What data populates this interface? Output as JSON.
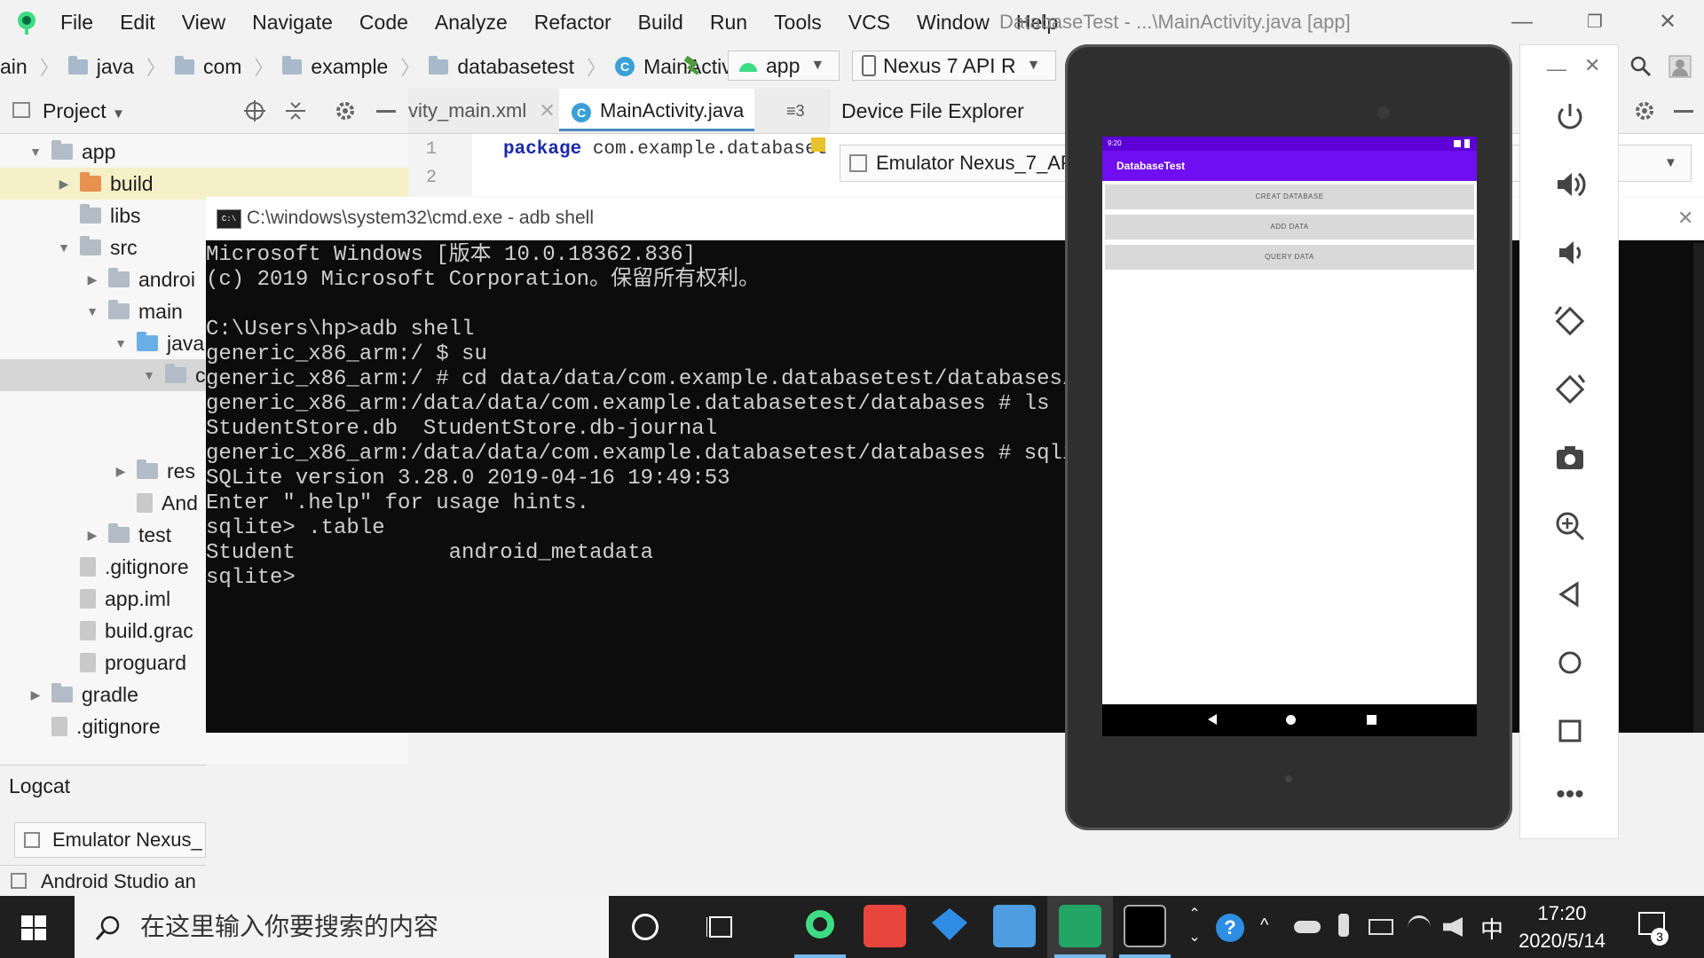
{
  "menubar": {
    "items": [
      "File",
      "Edit",
      "View",
      "Navigate",
      "Code",
      "Analyze",
      "Refactor",
      "Build",
      "Run",
      "Tools",
      "VCS",
      "Window",
      "Help"
    ],
    "window_title": "DatabaseTest - ...\\MainActivity.java [app]",
    "controls": [
      "—",
      "❐",
      "✕"
    ]
  },
  "navbar": {
    "breadcrumbs": [
      "ain",
      "java",
      "com",
      "example",
      "databasetest",
      "MainActivity"
    ],
    "run_config": "app",
    "device": "Nexus 7 API R"
  },
  "project_panel": {
    "title": "Project",
    "tree": [
      {
        "label": "app",
        "indent": 0,
        "arrow": "▼",
        "icon": "f-gray",
        "selected": false
      },
      {
        "label": "build",
        "indent": 1,
        "arrow": "▶",
        "icon": "f-orange",
        "selected": false,
        "hilite": true
      },
      {
        "label": "libs",
        "indent": 1,
        "arrow": "",
        "icon": "f-gray",
        "selected": false
      },
      {
        "label": "src",
        "indent": 1,
        "arrow": "▼",
        "icon": "f-gray",
        "selected": false
      },
      {
        "label": "androi",
        "indent": 2,
        "arrow": "▶",
        "icon": "f-gray",
        "selected": false
      },
      {
        "label": "main",
        "indent": 2,
        "arrow": "▼",
        "icon": "f-gray",
        "selected": false
      },
      {
        "label": "java",
        "indent": 3,
        "arrow": "▼",
        "icon": "f-blue",
        "selected": false
      },
      {
        "label": "c",
        "indent": 4,
        "arrow": "▼",
        "icon": "f-gray",
        "selected": true
      },
      {
        "label": "",
        "indent": 4,
        "arrow": "",
        "icon": "",
        "selected": false
      },
      {
        "label": "",
        "indent": 4,
        "arrow": "",
        "icon": "",
        "selected": false
      },
      {
        "label": "res",
        "indent": 3,
        "arrow": "▶",
        "icon": "f-gray",
        "selected": false
      },
      {
        "label": "And",
        "indent": 3,
        "arrow": "",
        "icon": "file",
        "selected": false
      },
      {
        "label": "test",
        "indent": 2,
        "arrow": "▶",
        "icon": "f-gray",
        "selected": false
      },
      {
        "label": ".gitignore",
        "indent": 1,
        "arrow": "",
        "icon": "file",
        "selected": false
      },
      {
        "label": "app.iml",
        "indent": 1,
        "arrow": "",
        "icon": "file",
        "selected": false
      },
      {
        "label": "build.grac",
        "indent": 1,
        "arrow": "",
        "icon": "file",
        "selected": false
      },
      {
        "label": "proguard",
        "indent": 1,
        "arrow": "",
        "icon": "file",
        "selected": false
      },
      {
        "label": "gradle",
        "indent": 0,
        "arrow": "▶",
        "icon": "f-gray",
        "selected": false
      },
      {
        "label": ".gitignore",
        "indent": 0,
        "arrow": "",
        "icon": "file",
        "selected": false
      }
    ]
  },
  "editor": {
    "tabs": [
      "vity_main.xml",
      "MainActivity.java"
    ],
    "tab_overflow": "≡3",
    "lines": [
      "1",
      "2"
    ],
    "code_keyword": "package",
    "code_rest": " com.example.databaset"
  },
  "device_file_explorer": {
    "title": "Device File Explorer",
    "device": "Emulator Nexus_7_AP"
  },
  "cmd": {
    "title": "C:\\windows\\system32\\cmd.exe - adb  shell",
    "lines": [
      "Microsoft Windows [版本 10.0.18362.836]",
      "(c) 2019 Microsoft Corporation。保留所有权利。",
      "",
      "C:\\Users\\hp>adb shell",
      "generic_x86_arm:/ $ su",
      "generic_x86_arm:/ # cd data/data/com.example.databasetest/databases/",
      "generic_x86_arm:/data/data/com.example.databasetest/databases # ls",
      "StudentStore.db  StudentStore.db-journal",
      "generic_x86_arm:/data/data/com.example.databasetest/databases # sqlit",
      "SQLite version 3.28.0 2019-04-16 19:49:53",
      "Enter \".help\" for usage hints.",
      "sqlite> .table",
      "Student            android_metadata",
      "sqlite>"
    ]
  },
  "logcat": {
    "title": "Logcat",
    "device": "Emulator Nexus_",
    "status": "Android Studio an"
  },
  "emulator": {
    "app_title": "DatabaseTest",
    "status_time": "9:20",
    "buttons": [
      "CREAT DATABASE",
      "ADD DATA",
      "QUERY DATA"
    ]
  },
  "taskbar": {
    "search_placeholder": "在这里输入你要搜索的内容",
    "time": "17:20",
    "date": "2020/5/14",
    "ime": "中",
    "notification_count": "3"
  }
}
